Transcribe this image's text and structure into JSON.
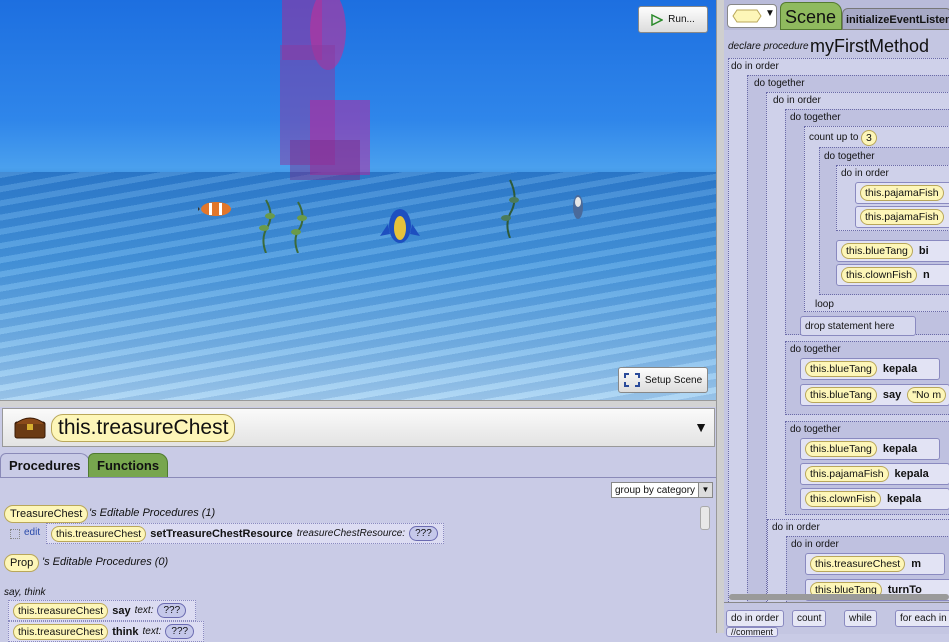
{
  "scene": {
    "run_label": "Run...",
    "setup_label": "Setup Scene"
  },
  "object_selector": {
    "selected": "this.treasureChest"
  },
  "tabs": {
    "procedures": "Procedures",
    "functions": "Functions"
  },
  "group_by": "group by category",
  "procedures": {
    "treasure_class": "TreasureChest",
    "treasure_title": "'s Editable Procedures (1)",
    "edit_label": "edit",
    "tile1_target": "this.treasureChest",
    "tile1_method": "setTreasureChestResource",
    "tile1_param": "treasureChestResource:",
    "tile1_value": "???",
    "prop_class": "Prop",
    "prop_title": "'s Editable Procedures (0)",
    "category": "say, think",
    "say_target": "this.treasureChest",
    "say_method": "say",
    "say_param": "text:",
    "say_value": "???",
    "think_target": "this.treasureChest",
    "think_method": "think",
    "think_param": "text:",
    "think_value": "???"
  },
  "editor": {
    "scene_tab": "Scene",
    "init_tab": "initializeEventListeners",
    "declare": "declare procedure",
    "method_name": "myFirstMethod",
    "do_in_order": "do in order",
    "do_together": "do together",
    "count_up_to": "count up to",
    "count_value": "3",
    "loop": "loop",
    "drop_here": "drop statement here",
    "pajama1": "this.pajamaFish",
    "pajama2": "this.pajamaFish",
    "bluetang1": "this.blueTang",
    "bluetang1_method": "bi",
    "clownfish1": "this.clownFish",
    "clownfish1_method": "n",
    "bluetang2": "this.blueTang",
    "bluetang2_method": "kepala",
    "bluetang3": "this.blueTang",
    "bluetang3_method": "say",
    "bluetang3_value": "\"No m",
    "bluetang4": "this.blueTang",
    "bluetang4_method": "kepala",
    "pajama3": "this.pajamaFish",
    "pajama3_method": "kepala",
    "clownfish2": "this.clownFish",
    "clownfish2_method": "kepala",
    "treasure2": "this.treasureChest",
    "treasure2_method": "m",
    "bluetang5": "this.blueTang",
    "bluetang5_method": "turnTo",
    "comment": "//comment"
  },
  "templates": {
    "do_in_order": "do in order",
    "count": "count",
    "while": "while",
    "for_each": "for each in"
  }
}
